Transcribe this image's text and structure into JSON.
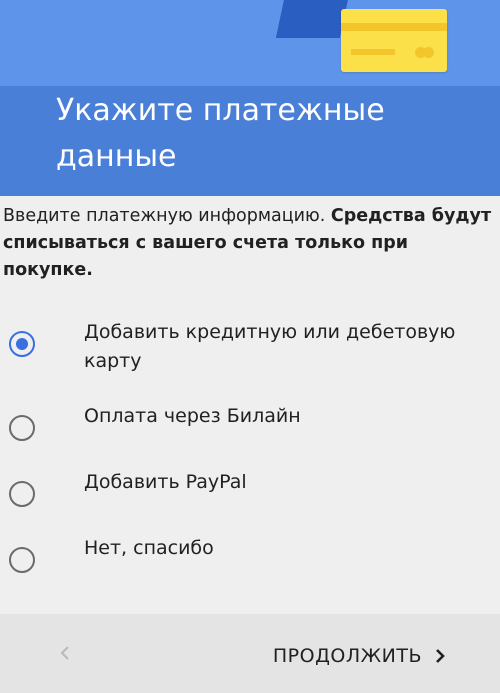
{
  "header": {
    "title_line1": "Укажите платежные",
    "title_line2": "данные"
  },
  "description": {
    "normal": "Введите платежную информацию. ",
    "bold": "Средства будут списываться с вашего счета только при покупке."
  },
  "options": [
    {
      "label": "Добавить кредитную или дебетовую карту",
      "checked": true
    },
    {
      "label": "Оплата через Билайн",
      "checked": false
    },
    {
      "label": "Добавить PayPal",
      "checked": false
    },
    {
      "label": "Нет, спасибо",
      "checked": false
    }
  ],
  "footer": {
    "continue_label": "ПРОДОЛЖИТЬ"
  },
  "colors": {
    "header": "#4a7fd8",
    "accent": "#3a6fe0",
    "card": "#fbe04a"
  },
  "icons": {
    "back": "chevron-left-icon",
    "continue": "chevron-right-icon",
    "illustration": "credit-card-icon"
  }
}
